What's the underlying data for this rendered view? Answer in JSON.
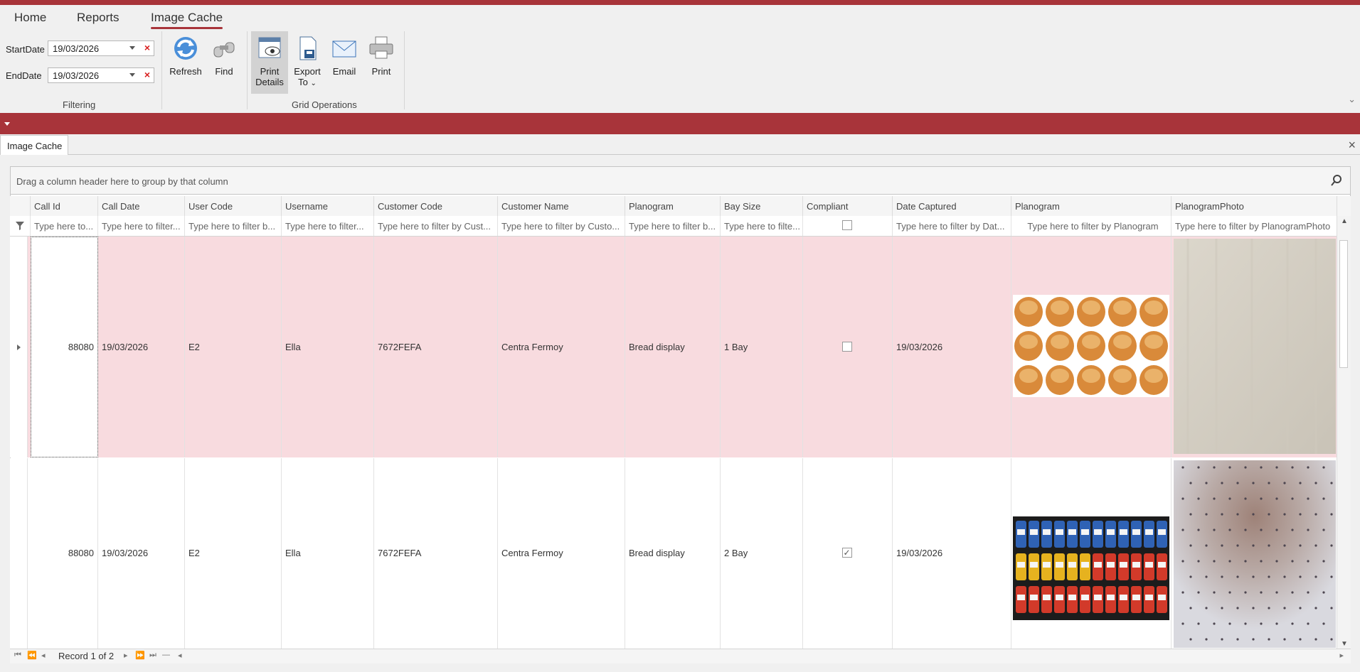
{
  "ribbon": {
    "tabs": [
      {
        "label": "Home"
      },
      {
        "label": "Reports"
      },
      {
        "label": "Image Cache",
        "active": true
      }
    ],
    "filtering": {
      "start_label": "StartDate",
      "start_value": "19/03/2026",
      "end_label": "EndDate",
      "end_value": "19/03/2026",
      "group_label": "Filtering",
      "clear_glyph": "×"
    },
    "buttons": {
      "refresh": "Refresh",
      "find": "Find",
      "print_details_1": "Print",
      "print_details_2": "Details",
      "export_1": "Export",
      "export_2": "To",
      "email": "Email",
      "print": "Print"
    },
    "grid_ops_label": "Grid Operations"
  },
  "document": {
    "tab_label": "Image Cache",
    "close_glyph": "×"
  },
  "grid": {
    "group_hint": "Drag a column header here to group by that column",
    "columns": [
      {
        "label": "Call Id",
        "filter": "Type here to..."
      },
      {
        "label": "Call Date",
        "filter": "Type here to filter..."
      },
      {
        "label": "User Code",
        "filter": "Type here to filter b..."
      },
      {
        "label": "Username",
        "filter": "Type here to filter..."
      },
      {
        "label": "Customer Code",
        "filter": "Type here to filter by Cust..."
      },
      {
        "label": "Customer Name",
        "filter": "Type here to filter by Custo..."
      },
      {
        "label": "Planogram",
        "filter": "Type here to filter b..."
      },
      {
        "label": "Bay Size",
        "filter": "Type here to filte..."
      },
      {
        "label": "Compliant",
        "filter": ""
      },
      {
        "label": "Date Captured",
        "filter": "Type here to filter by Dat..."
      },
      {
        "label": "Planogram",
        "filter": "Type here to filter by Planogram"
      },
      {
        "label": "PlanogramPhoto",
        "filter": "Type here to filter by PlanogramPhoto"
      }
    ],
    "rows": [
      {
        "call_id": "88080",
        "call_date": "19/03/2026",
        "user_code": "E2",
        "username": "Ella",
        "customer_code": "7672FEFA",
        "customer_name": "Centra Fermoy",
        "planogram": "Bread display",
        "bay_size": "1 Bay",
        "compliant": false,
        "date_captured": "19/03/2026"
      },
      {
        "call_id": "88080",
        "call_date": "19/03/2026",
        "user_code": "E2",
        "username": "Ella",
        "customer_code": "7672FEFA",
        "customer_name": "Centra Fermoy",
        "planogram": "Bread display",
        "bay_size": "2 Bay",
        "compliant": true,
        "date_captured": "19/03/2026"
      }
    ],
    "record_text": "Record 1 of 2",
    "check_glyph": "✓"
  },
  "colors": {
    "accent": "#a8343a",
    "selected_row": "#f8dbdf"
  }
}
